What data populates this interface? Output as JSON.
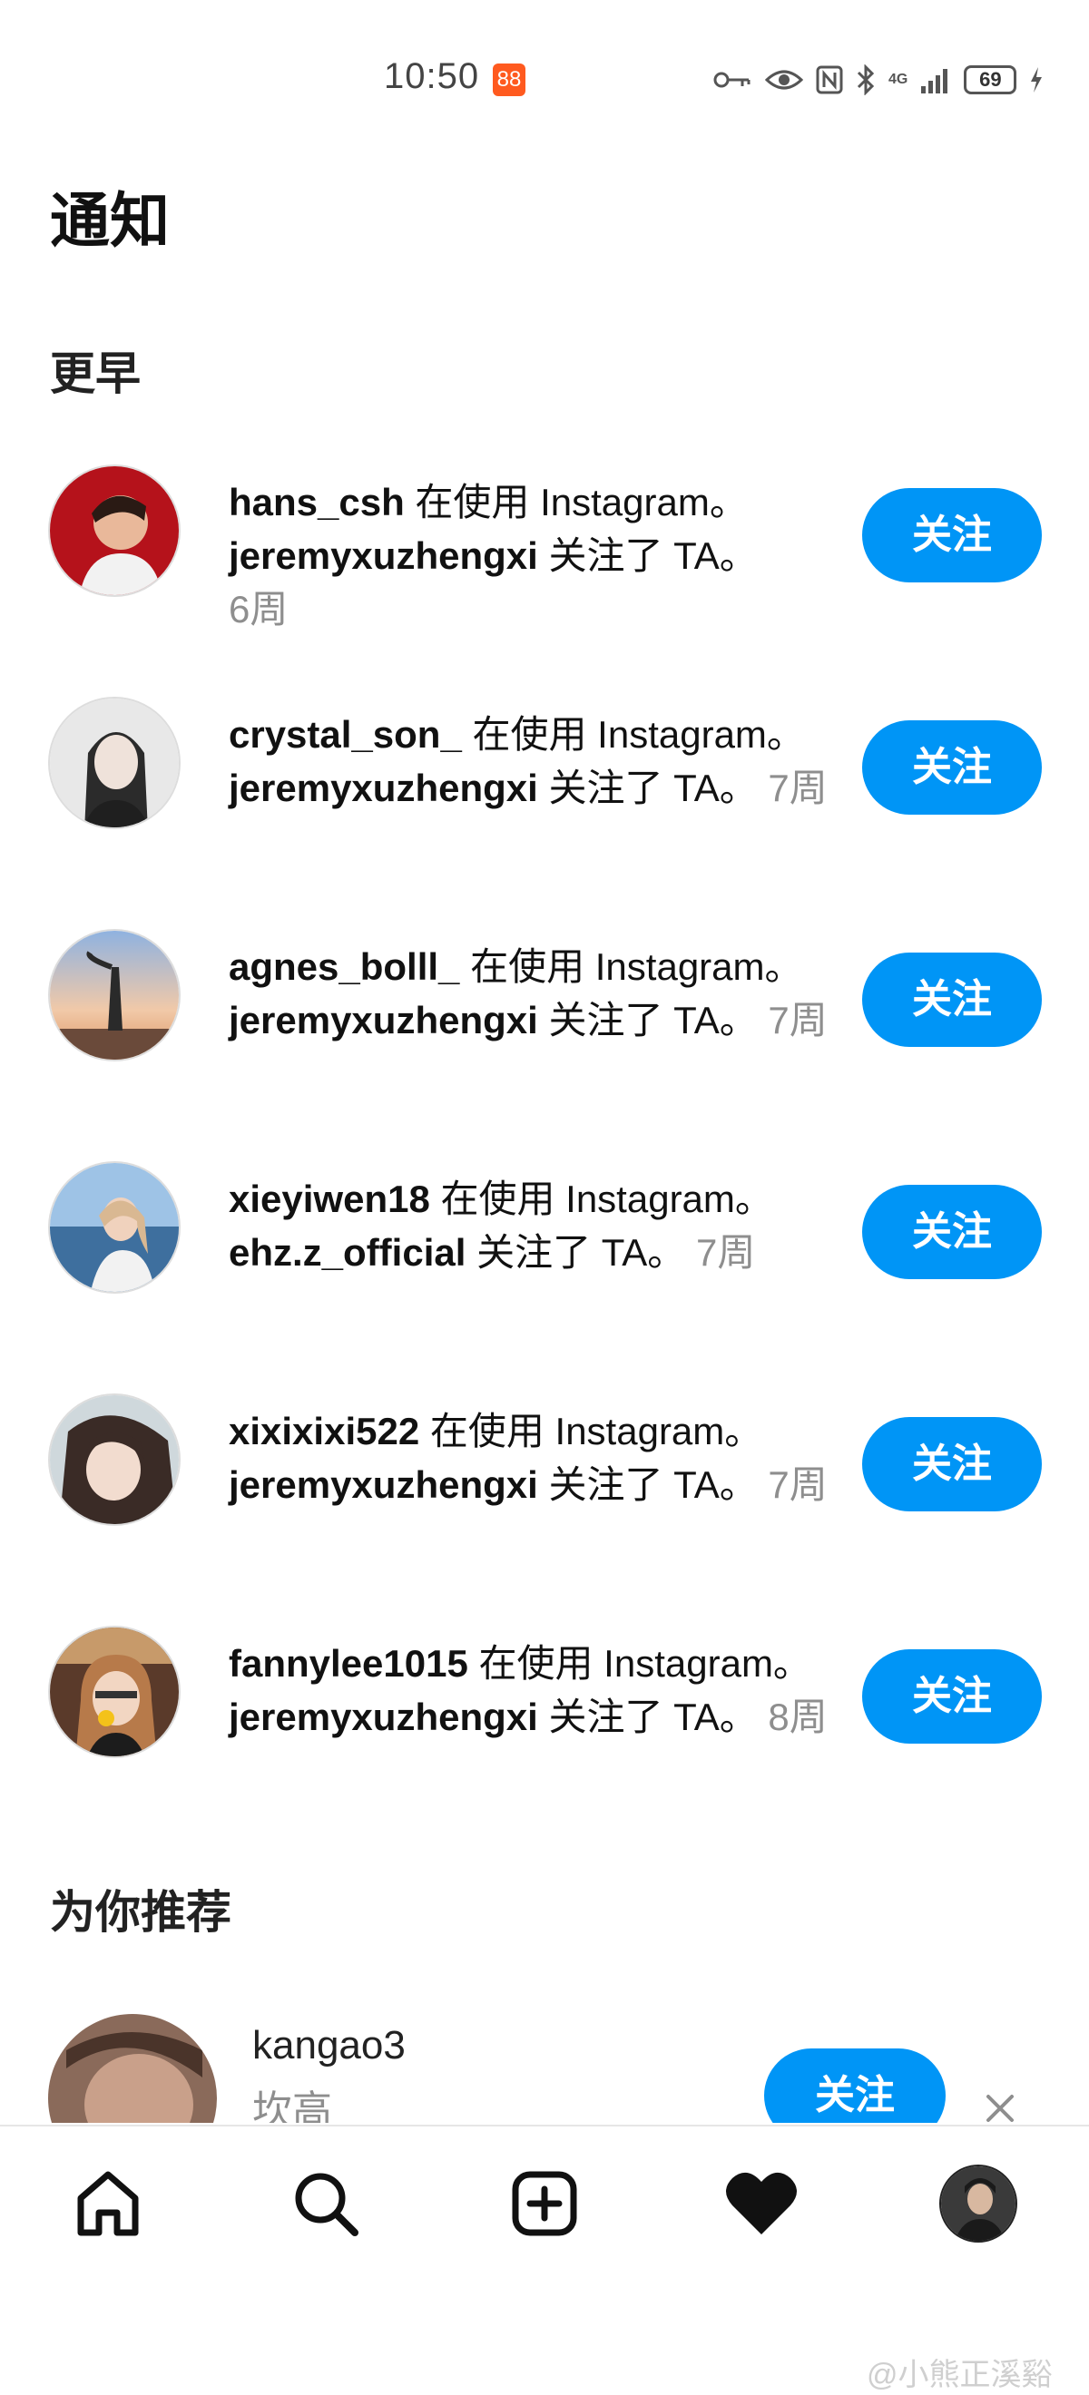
{
  "status_bar": {
    "time": "10:50",
    "app_badge": "88",
    "battery": "69",
    "network": "4G",
    "icons": [
      "key-icon",
      "eye-icon",
      "nfc-icon",
      "bluetooth-icon",
      "signal-icon",
      "battery-icon",
      "charging-icon"
    ]
  },
  "page": {
    "title": "通知"
  },
  "sections": {
    "earlier": "更早",
    "suggested": "为你推荐"
  },
  "notifications": [
    {
      "username": "hans_csh",
      "using": " 在使用 Instagram。",
      "follower": "jeremyxuzhengxi",
      "followed": " 关注了 TA。",
      "time": "6周",
      "button": "关注"
    },
    {
      "username": "crystal_son_",
      "using": " 在使用 Instagram。",
      "follower": "jeremyxuzhengxi",
      "followed": " 关注了 TA。",
      "time": "7周",
      "button": "关注"
    },
    {
      "username": "agnes_bolll_",
      "using": " 在使用 Instagram。",
      "follower": "jeremyxuzhengxi",
      "followed": " 关注了 TA。",
      "time": "7周",
      "button": "关注"
    },
    {
      "username": "xieyiwen18",
      "using": " 在使用 Instagram。",
      "follower": "ehz.z_official",
      "followed": " 关注了 TA。",
      "time": "7周",
      "button": "关注"
    },
    {
      "username": "xixixixi522",
      "using": " 在使用 Instagram。",
      "follower": "jeremyxuzhengxi",
      "followed": " 关注了 TA。",
      "time": "7周",
      "button": "关注"
    },
    {
      "username": "fannylee1015",
      "using": " 在使用 Instagram。",
      "follower": "jeremyxuzhengxi",
      "followed": " 关注了 TA。",
      "time": "8周",
      "button": "关注"
    }
  ],
  "suggestion": {
    "username": "kangao3",
    "full_name": "坎高",
    "button": "关注"
  },
  "bottom_nav": [
    "home-icon",
    "search-icon",
    "new-post-icon",
    "activity-icon",
    "profile-avatar"
  ],
  "watermark": "@小熊正溪谿",
  "colors": {
    "accent": "#0095f6",
    "secondary_text": "#8e8e8e",
    "status_badge": "#ff5a1f"
  }
}
